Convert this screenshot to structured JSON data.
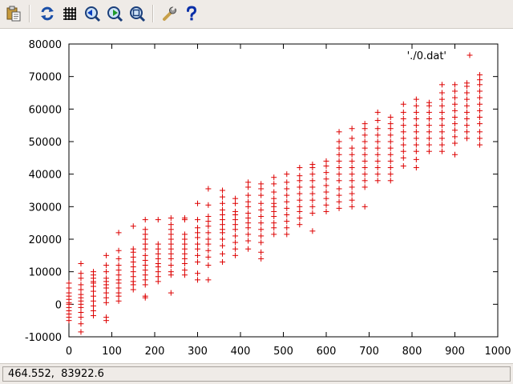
{
  "toolbar": {
    "buttons": [
      {
        "id": "copy",
        "icon": "copy-to-clipboard-icon"
      },
      {
        "id": "replot",
        "icon": "replot-icon"
      },
      {
        "id": "grid",
        "icon": "grid-icon"
      },
      {
        "id": "zoom-previous",
        "icon": "zoom-previous-icon"
      },
      {
        "id": "zoom-next",
        "icon": "zoom-next-icon"
      },
      {
        "id": "autoscale",
        "icon": "autoscale-icon"
      },
      {
        "id": "options",
        "icon": "wrench-icon"
      },
      {
        "id": "help",
        "icon": "help-icon"
      }
    ]
  },
  "status": {
    "coordinates": "464.552,  83922.6"
  },
  "colors": {
    "series": "#dd0000",
    "background": "#ffffff",
    "window": "#efebe7"
  },
  "chart_data": {
    "type": "scatter",
    "title": "",
    "xlabel": "",
    "ylabel": "",
    "xlim": [
      0,
      1000
    ],
    "ylim": [
      -10000,
      80000
    ],
    "xticks": [
      0,
      100,
      200,
      300,
      400,
      500,
      600,
      700,
      800,
      900,
      1000
    ],
    "yticks": [
      -10000,
      0,
      10000,
      20000,
      30000,
      40000,
      50000,
      60000,
      70000,
      80000
    ],
    "xtick_labels": [
      "0",
      "100",
      "200",
      "300",
      "400",
      "500",
      "600",
      "700",
      "800",
      "900",
      "1000"
    ],
    "ytick_labels": [
      "-10000",
      "0",
      "10000",
      "20000",
      "30000",
      "40000",
      "50000",
      "60000",
      "70000",
      "80000"
    ],
    "grid": false,
    "legend": "top-right",
    "marker": "+",
    "series": [
      {
        "name": "'./0.dat'",
        "columns": [
          {
            "x": 0,
            "y": [
              -5000,
              -4000,
              -3000,
              -2000,
              -1000,
              0,
              500,
              1500,
              2500,
              3500,
              5000,
              6500
            ]
          },
          {
            "x": 28,
            "y": [
              -8500,
              -6000,
              -4000,
              -2500,
              -1000,
              0,
              1000,
              2000,
              3000,
              4500,
              6000,
              8000,
              9500,
              12500
            ]
          },
          {
            "x": 57,
            "y": [
              -3500,
              -2000,
              -500,
              1000,
              2500,
              4000,
              5500,
              6500,
              7000,
              8000,
              9000,
              10000
            ]
          },
          {
            "x": 87,
            "y": [
              -5000,
              -4000,
              500,
              2000,
              3500,
              5000,
              6000,
              7000,
              8000,
              10000,
              12000,
              15000
            ]
          },
          {
            "x": 116,
            "y": [
              1000,
              2500,
              3500,
              5000,
              6500,
              7500,
              9000,
              10500,
              12000,
              14000,
              16500,
              22000
            ]
          },
          {
            "x": 150,
            "y": [
              4500,
              6000,
              7000,
              8500,
              10000,
              11500,
              13000,
              14500,
              16000,
              17000,
              24000
            ]
          },
          {
            "x": 178,
            "y": [
              2000,
              2500,
              6000,
              7500,
              9000,
              10500,
              12000,
              13500,
              15000,
              17000,
              18500,
              20000,
              21500,
              23000,
              26000
            ]
          },
          {
            "x": 208,
            "y": [
              7000,
              8500,
              10000,
              11500,
              12500,
              14000,
              15500,
              17000,
              18500,
              26000
            ]
          },
          {
            "x": 238,
            "y": [
              3500,
              9000,
              10000,
              12000,
              14000,
              15500,
              17000,
              18500,
              20000,
              21500,
              23000,
              24500,
              26500
            ]
          },
          {
            "x": 270,
            "y": [
              9000,
              10500,
              12500,
              14000,
              15500,
              17000,
              18500,
              20000,
              21500,
              26000,
              26500
            ]
          },
          {
            "x": 300,
            "y": [
              7500,
              9500,
              13000,
              15000,
              17000,
              18500,
              20500,
              22000,
              23500,
              26000,
              31000
            ]
          },
          {
            "x": 325,
            "y": [
              7500,
              12000,
              14500,
              16500,
              18500,
              20000,
              22000,
              24000,
              25500,
              27000,
              30500,
              35500
            ]
          },
          {
            "x": 358,
            "y": [
              13000,
              15500,
              18000,
              20000,
              22000,
              23000,
              24500,
              26000,
              27500,
              29000,
              31000,
              33000,
              35000
            ]
          },
          {
            "x": 388,
            "y": [
              15000,
              17000,
              19000,
              21000,
              23000,
              24500,
              26000,
              27500,
              28500,
              31000,
              32500
            ]
          },
          {
            "x": 418,
            "y": [
              17000,
              19500,
              21500,
              23500,
              25000,
              26500,
              28000,
              30000,
              31500,
              33500,
              36000,
              37500
            ]
          },
          {
            "x": 448,
            "y": [
              14000,
              16000,
              19000,
              21000,
              23000,
              25000,
              27000,
              29000,
              31000,
              33500,
              35500,
              37000
            ]
          },
          {
            "x": 478,
            "y": [
              21500,
              23500,
              25000,
              27000,
              28500,
              30000,
              31000,
              32500,
              34500,
              37000,
              39000
            ]
          },
          {
            "x": 508,
            "y": [
              21500,
              23500,
              25500,
              27500,
              29500,
              31500,
              33500,
              35500,
              37500,
              40000
            ]
          },
          {
            "x": 538,
            "y": [
              24500,
              26500,
              28500,
              30000,
              32000,
              34000,
              36000,
              38000,
              39500,
              42000
            ]
          },
          {
            "x": 568,
            "y": [
              22500,
              28000,
              30000,
              32000,
              34000,
              36000,
              38000,
              40000,
              42000,
              43000
            ]
          },
          {
            "x": 600,
            "y": [
              28500,
              30500,
              32500,
              34500,
              36500,
              38500,
              40500,
              42500,
              44000
            ]
          },
          {
            "x": 630,
            "y": [
              29500,
              31500,
              33500,
              35500,
              38000,
              40000,
              42000,
              44000,
              46000,
              48000,
              50000,
              53000
            ]
          },
          {
            "x": 660,
            "y": [
              30000,
              32000,
              34000,
              36000,
              38000,
              40000,
              42000,
              44000,
              46000,
              48000,
              51000,
              54000
            ]
          },
          {
            "x": 690,
            "y": [
              30000,
              36000,
              38000,
              40000,
              42000,
              44000,
              46000,
              48000,
              50000,
              52000,
              54000,
              55500
            ]
          },
          {
            "x": 720,
            "y": [
              38000,
              40000,
              42000,
              44000,
              46000,
              48000,
              50000,
              52000,
              54000,
              56500,
              59000
            ]
          },
          {
            "x": 750,
            "y": [
              38000,
              40000,
              42000,
              44000,
              46000,
              48000,
              50000,
              52000,
              54000,
              55500,
              57500
            ]
          },
          {
            "x": 780,
            "y": [
              42500,
              45000,
              47000,
              49000,
              51000,
              53000,
              55000,
              57000,
              59000,
              61500
            ]
          },
          {
            "x": 810,
            "y": [
              42000,
              44500,
              47000,
              49000,
              51000,
              53000,
              55000,
              57000,
              59000,
              61000,
              63000
            ]
          },
          {
            "x": 840,
            "y": [
              47000,
              49000,
              51000,
              53000,
              55000,
              57000,
              59000,
              61000,
              62000
            ]
          },
          {
            "x": 870,
            "y": [
              47000,
              49000,
              51000,
              53000,
              55000,
              57000,
              59000,
              61000,
              63000,
              65000,
              67500
            ]
          },
          {
            "x": 900,
            "y": [
              46000,
              49500,
              51500,
              53500,
              55500,
              57500,
              59500,
              61500,
              63500,
              65500,
              67500
            ]
          },
          {
            "x": 928,
            "y": [
              51000,
              53000,
              55000,
              57000,
              59000,
              61000,
              63000,
              65000,
              67000,
              68000
            ]
          },
          {
            "x": 958,
            "y": [
              49000,
              51000,
              53000,
              55500,
              57500,
              59500,
              61500,
              63500,
              65500,
              67500,
              69000,
              70500
            ]
          }
        ]
      }
    ]
  }
}
